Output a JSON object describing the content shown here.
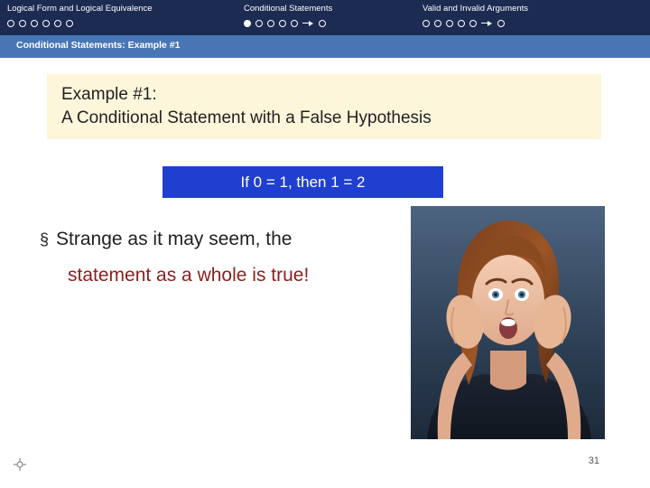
{
  "topnav": {
    "groups": [
      {
        "title": "Logical Form and Logical Equivalence",
        "dots": [
          "empty",
          "empty",
          "empty",
          "empty",
          "empty",
          "empty"
        ]
      },
      {
        "title": "Conditional Statements",
        "dots": [
          "filled",
          "empty",
          "empty",
          "empty",
          "empty",
          "arrow",
          "empty"
        ]
      },
      {
        "title": "Valid and Invalid Arguments",
        "dots": [
          "empty",
          "empty",
          "empty",
          "empty",
          "empty",
          "arrow",
          "empty"
        ]
      }
    ]
  },
  "subheader": {
    "breadcrumb": "Conditional Statements: Example #1"
  },
  "title": {
    "line1": "Example #1:",
    "line2": "A Conditional Statement with a False Hypothesis"
  },
  "statement": {
    "text": "If 0 = 1, then 1 = 2"
  },
  "bullet": {
    "marker": "§",
    "line1": "Strange as it may seem, the",
    "line2": "statement as a whole is true!"
  },
  "footer": {
    "page_number": "31"
  },
  "colors": {
    "topbar": "#1c2b52",
    "subbar": "#4876b5",
    "title_box": "#fdf6db",
    "statement_bar": "#1f3fd0",
    "accent_red": "#8c2020"
  }
}
